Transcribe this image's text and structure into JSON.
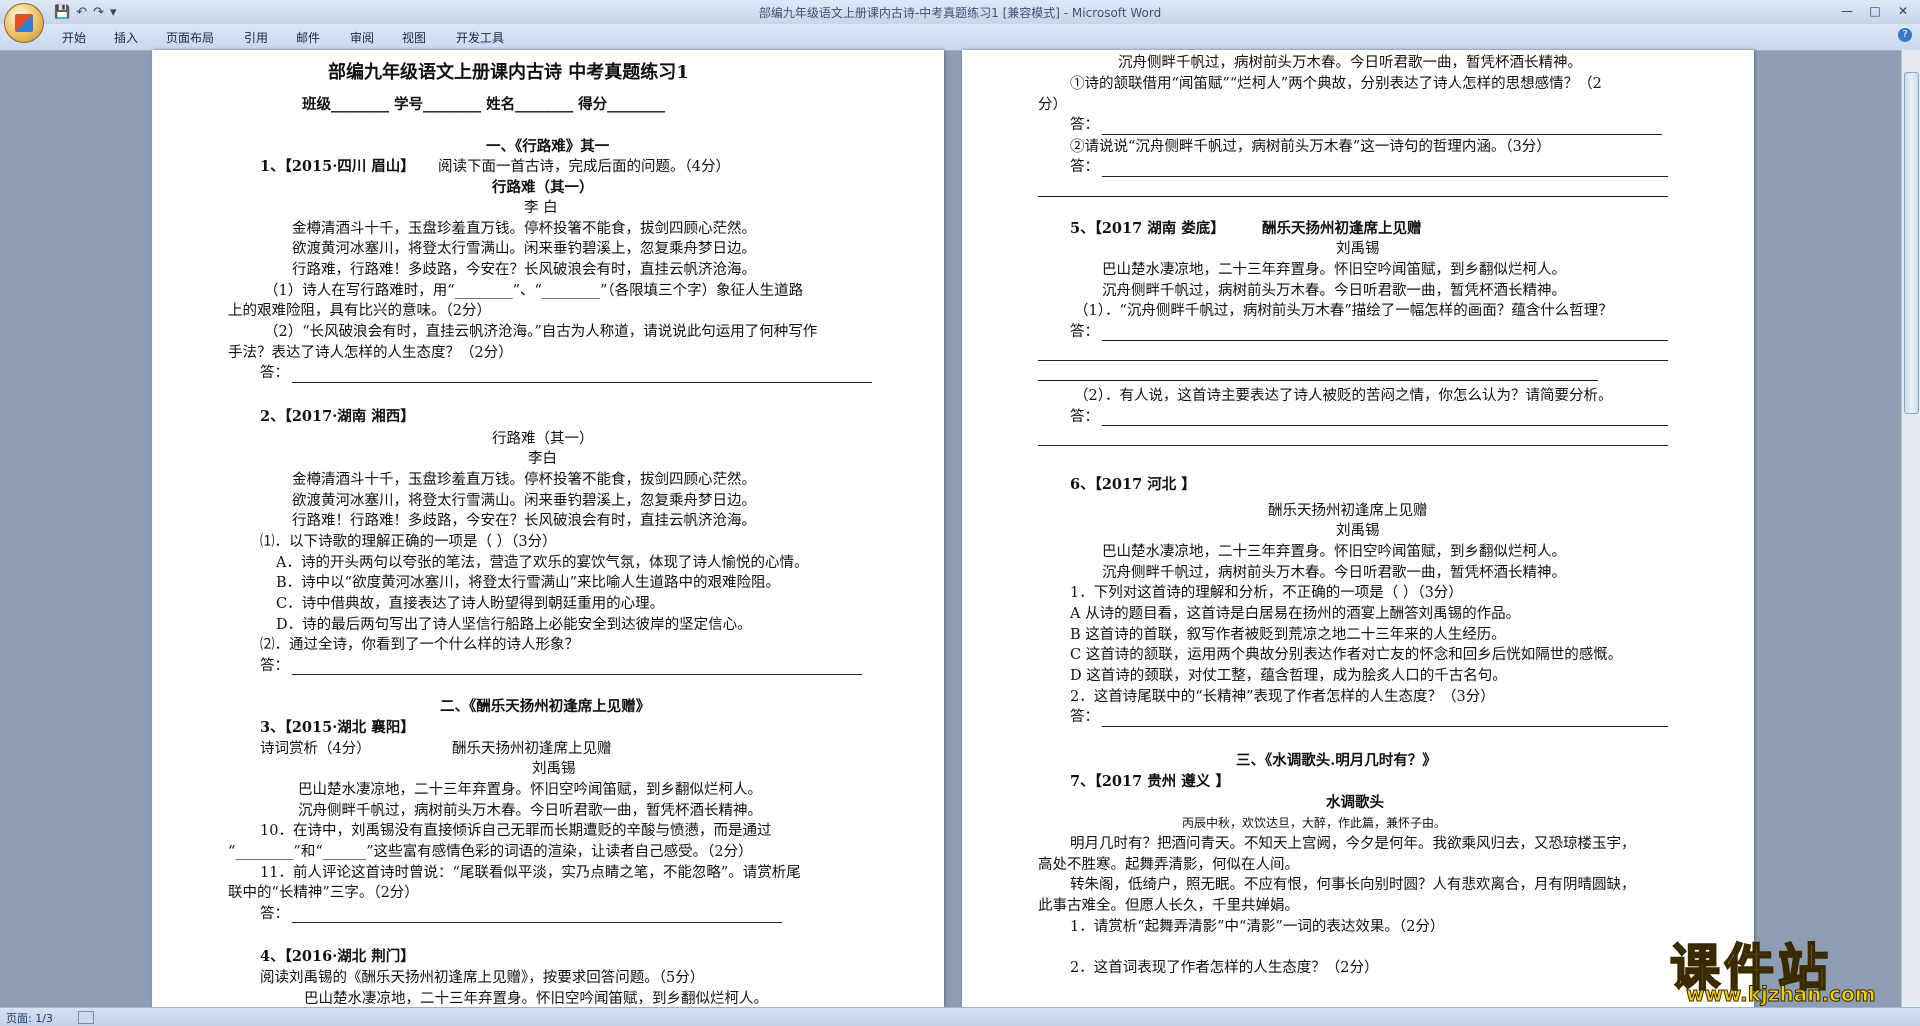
{
  "window": {
    "title": "部编九年级语文上册课内古诗-中考真题练习1 [兼容模式] - Microsoft Word"
  },
  "ribbon": {
    "tabs": [
      "开始",
      "插入",
      "页面布局",
      "引用",
      "邮件",
      "审阅",
      "视图",
      "开发工具"
    ]
  },
  "status": {
    "page": "页面: 1/3"
  },
  "watermark": {
    "text": "课件站",
    "url": "www.kjzhan.com"
  },
  "left_page": [
    "部编九年级语文上册课内古诗 中考真题练习1",
    "班级________ 学号________ 姓名________ 得分________",
    "一、《行路难》其一",
    "1、【2015·四川 眉山】",
    "阅读下面一首古诗，完成后面的问题。（4分）",
    "行路难（其一）",
    "李 白",
    "金樽清酒斗十千，玉盘珍羞直万钱。停杯投箸不能食，拔剑四顾心茫然。",
    "欲渡黄河冰塞川，将登太行雪满山。闲来垂钓碧溪上，忽复乘舟梦日边。",
    "行路难，行路难！多歧路，今安在？长风破浪会有时，直挂云帆济沧海。",
    "（1）诗人在写行路难时，用“________”、“________”（各限填三个字）象征人生道路",
    "上的艰难险阻，具有比兴的意味。（2分）",
    "（2）“长风破浪会有时，直挂云帆济沧海。”自古为人称道，请说说此句运用了何种写作",
    "手法？表达了诗人怎样的人生态度？（2分）",
    "答：",
    "2、【2017·湖南 湘西】",
    "行路难（其一）",
    "李白",
    "金樽清酒斗十千，玉盘珍羞直万钱。停杯投箸不能食，拔剑四顾心茫然。",
    "欲渡黄河冰塞川，将登太行雪满山。闲来垂钓碧溪上，忽复乘舟梦日边。",
    "行路难！行路难！多歧路，今安在？长风破浪会有时，直挂云帆济沧海。",
    "⑴．以下诗歌的理解正确的一项是（    ）（3分）",
    "A．诗的开头两句以夸张的笔法，营造了欢乐的宴饮气氛，体现了诗人愉悦的心情。",
    "B．诗中以“欲度黄河冰塞川，将登太行雪满山”来比喻人生道路中的艰难险阻。",
    "C．诗中借典故，直接表达了诗人盼望得到朝廷重用的心理。",
    "D．诗的最后两句写出了诗人坚信行船路上必能安全到达彼岸的坚定信心。",
    "⑵．通过全诗，你看到了一个什么样的诗人形象？",
    "答：",
    "二、《酬乐天扬州初逢席上见赠》",
    "3、【2015·湖北 襄阳】",
    "诗词赏析（4分）",
    "酬乐天扬州初逢席上见赠",
    "刘禹锡",
    "巴山楚水凄凉地，二十三年弃置身。怀旧空吟闻笛赋，到乡翻似烂柯人。",
    "沉舟侧畔千帆过，病树前头万木春。今日听君歌一曲，暂凭杯酒长精神。",
    "10．在诗中，刘禹锡没有直接倾诉自己无罪而长期遭贬的辛酸与愤懑，而是通过",
    "“________”和“______”这些富有感情色彩的词语的渲染，让读者自己感受。（2分）",
    "11．前人评论这首诗时曾说：“尾联看似平淡，实乃点睛之笔，不能忽略”。请赏析尾",
    "联中的“长精神”三字。（2分）",
    "答：",
    "4、【2016·湖北 荆门】",
    "阅读刘禹锡的《酬乐天扬州初逢席上见赠》，按要求回答问题。（5分）",
    "巴山楚水凄凉地，二十三年弃置身。怀旧空吟闻笛赋，到乡翻似烂柯人。"
  ],
  "right_page": [
    "沉舟侧畔千帆过，病树前头万木春。今日听君歌一曲，暂凭杯酒长精神。",
    "①诗的颔联借用“闻笛赋”“烂柯人”两个典故，分别表达了诗人怎样的思想感情？（2",
    "分）",
    "答：",
    "②请说说“沉舟侧畔千帆过，病树前头万木春”这一诗句的哲理内涵。（3分）",
    "答：",
    "5、【2017 湖南 娄底】",
    "酬乐天扬州初逢席上见赠",
    "刘禹锡",
    "巴山楚水凄凉地，二十三年弃置身。怀旧空吟闻笛赋，到乡翻似烂柯人。",
    "沉舟侧畔千帆过，病树前头万木春。今日听君歌一曲，暂凭杯酒长精神。",
    "（1）．“沉舟侧畔千帆过，病树前头万木春”描绘了一幅怎样的画面？蕴含什么哲理？",
    "答：",
    "（2）．有人说，这首诗主要表达了诗人被贬的苦闷之情，你怎么认为？请简要分析。",
    "答：",
    "6、【2017 河北 】",
    "酬乐天扬州初逢席上见赠",
    "刘禹锡",
    "巴山楚水凄凉地，二十三年弃置身。怀旧空吟闻笛赋，到乡翻似烂柯人。",
    "沉舟侧畔千帆过，病树前头万木春。今日听君歌一曲，暂凭杯酒长精神。",
    "1．下列对这首诗的理解和分析，不正确的一项是（    ）（3分）",
    "A 从诗的题目看，这首诗是白居易在扬州的酒宴上酬答刘禹锡的作品。",
    "B 这首诗的首联，叙写作者被贬到荒凉之地二十三年来的人生经历。",
    "C 这首诗的颔联，运用两个典故分别表达作者对亡友的怀念和回乡后恍如隔世的感慨。",
    "D 这首诗的颈联，对仗工整，蕴含哲理，成为脍炙人口的千古名句。",
    "2．这首诗尾联中的“长精神”表现了作者怎样的人生态度？（3分）",
    "答：",
    "三、《水调歌头.明月几时有？》",
    "7、【2017 贵州 遵义 】",
    "水调歌头",
    "丙辰中秋，欢饮达旦，大醉，作此篇，兼怀子由。",
    "明月几时有？把酒问青天。不知天上宫阙，今夕是何年。我欲乘风归去，又恐琼楼玉宇，",
    "高处不胜寒。起舞弄清影，何似在人间。",
    "转朱阁，低绮户，照无眠。不应有恨，何事长向别时圆？人有悲欢离合，月有阴晴圆缺，",
    "此事古难全。但愿人长久，千里共婵娟。",
    "1．请赏析“起舞弄清影”中“清影”一词的表达效果。（2分）",
    "2．这首词表现了作者怎样的人生态度？（2分）"
  ]
}
